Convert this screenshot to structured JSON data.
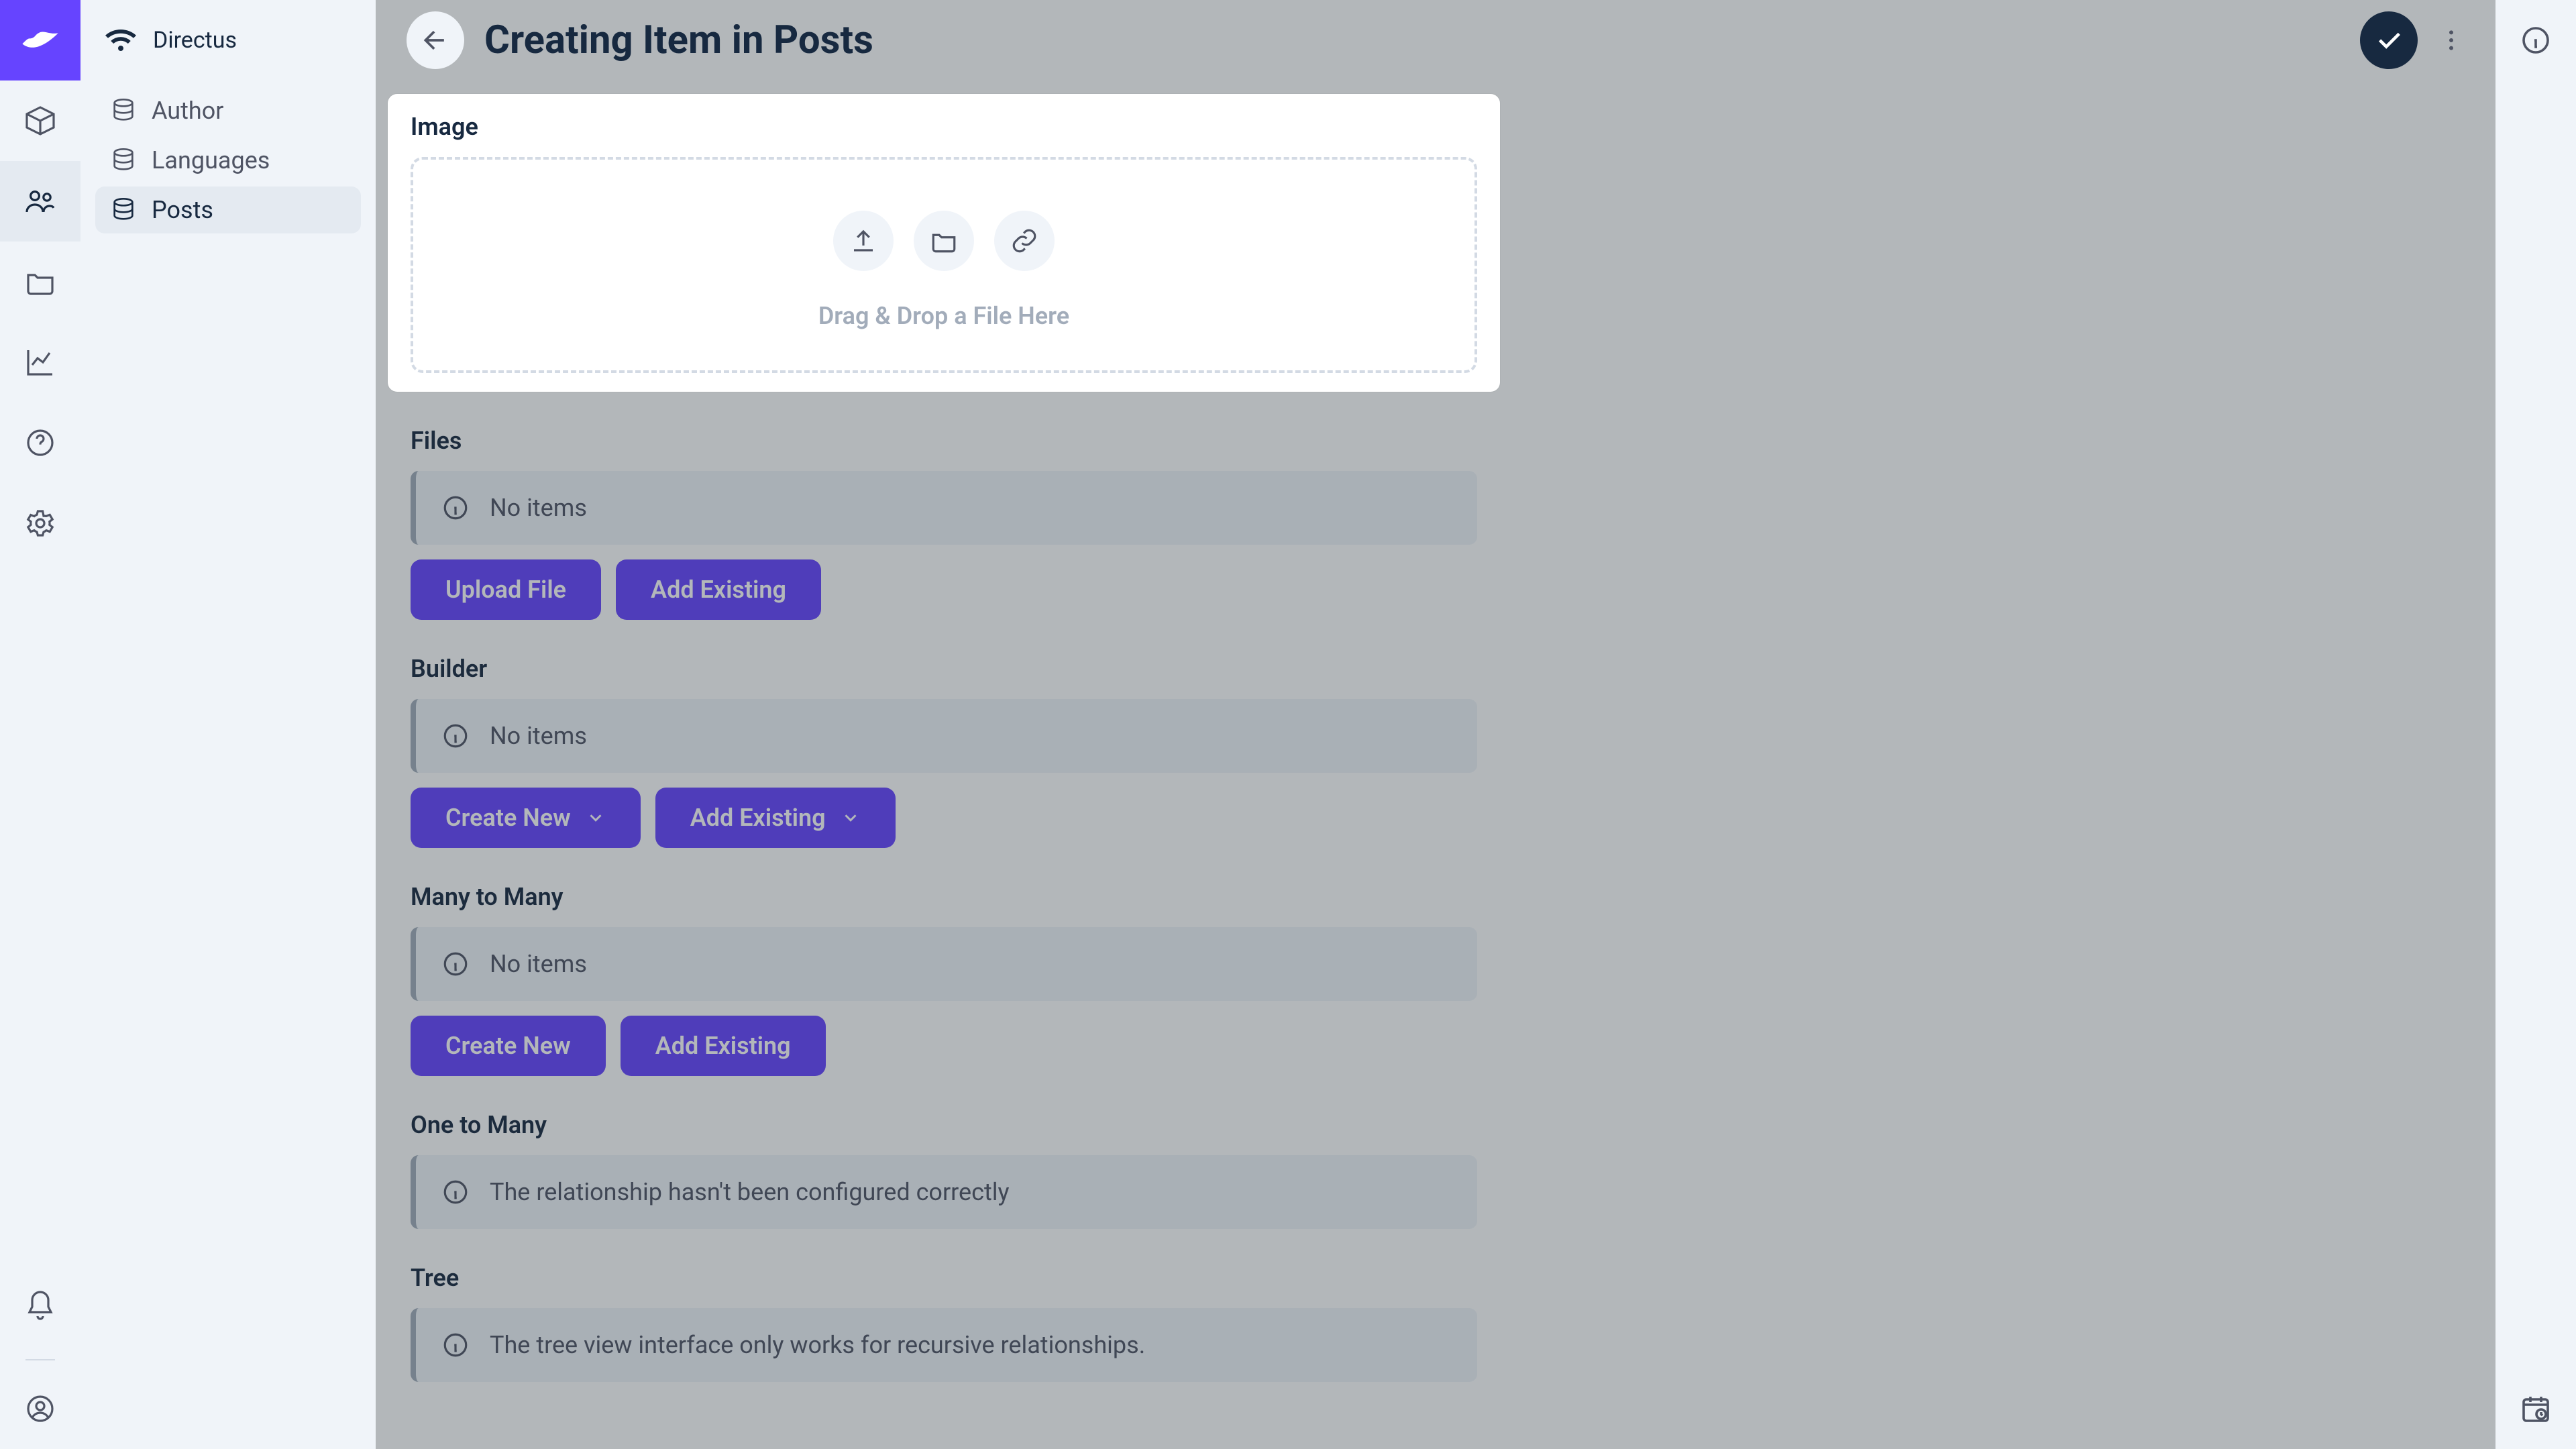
{
  "brand": {
    "name": "Directus"
  },
  "sidebar": {
    "items": [
      {
        "label": "Author"
      },
      {
        "label": "Languages"
      },
      {
        "label": "Posts"
      }
    ],
    "active_index": 2
  },
  "header": {
    "title": "Creating Item in Posts"
  },
  "sections": {
    "image": {
      "label": "Image",
      "dropzone_text": "Drag & Drop a File Here"
    },
    "files": {
      "label": "Files",
      "empty_text": "No items",
      "upload_button": "Upload File",
      "add_existing_button": "Add Existing"
    },
    "builder": {
      "label": "Builder",
      "empty_text": "No items",
      "create_button": "Create New",
      "add_existing_button": "Add Existing"
    },
    "many_to_many": {
      "label": "Many to Many",
      "empty_text": "No items",
      "create_button": "Create New",
      "add_existing_button": "Add Existing"
    },
    "one_to_many": {
      "label": "One to Many",
      "error_text": "The relationship hasn't been configured correctly"
    },
    "tree": {
      "label": "Tree",
      "error_text": "The tree view interface only works for recursive relationships."
    }
  },
  "colors": {
    "accent": "#6644ff",
    "text": "#172940",
    "muted": "#a2acba"
  }
}
